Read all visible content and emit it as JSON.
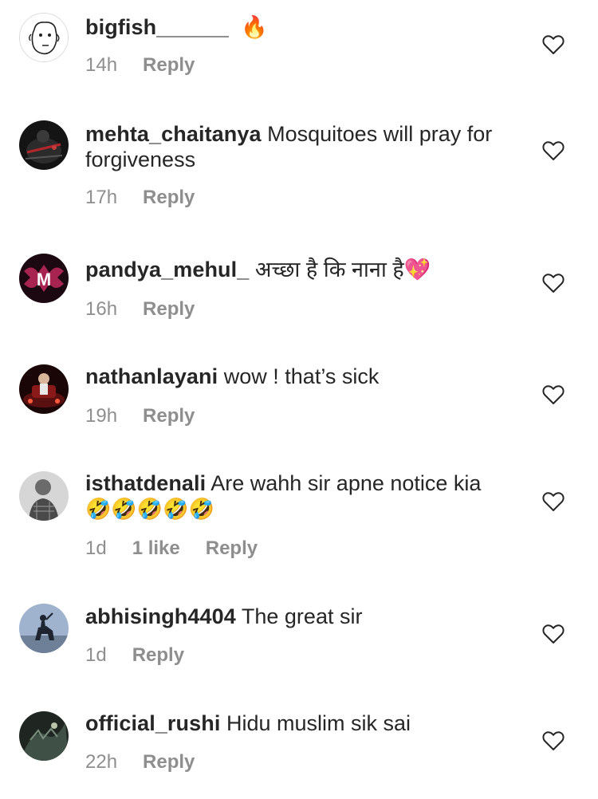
{
  "comments": [
    {
      "username": "bigfish______",
      "text": "🔥",
      "time": "14h",
      "likes": "",
      "reply_label": "Reply",
      "avatar_icon": "meme-face-avatar",
      "avatar_color": "#ffffff"
    },
    {
      "username": "mehta_chaitanya",
      "text": "Mosquitoes will pray for forgiveness",
      "time": "17h",
      "likes": "",
      "reply_label": "Reply",
      "avatar_icon": "dark-figure-avatar",
      "avatar_color": "#1b1b1b"
    },
    {
      "username": "pandya_mehul_",
      "text": "अच्छा है कि नाना है💖",
      "time": "16h",
      "likes": "",
      "reply_label": "Reply",
      "avatar_icon": "pink-m-logo-avatar",
      "avatar_color": "#2a0a14"
    },
    {
      "username": "nathanlayani",
      "text": "wow ! that’s sick",
      "time": "19h",
      "likes": "",
      "reply_label": "Reply",
      "avatar_icon": "car-photo-avatar",
      "avatar_color": "#3a0c0c"
    },
    {
      "username": "isthatdenali",
      "text": "Are wahh sir apne notice kia",
      "emojis": "🤣🤣🤣🤣🤣",
      "time": "1d",
      "likes": "1 like",
      "reply_label": "Reply",
      "avatar_icon": "person-photo-avatar",
      "avatar_color": "#9a9a9a"
    },
    {
      "username": "abhisingh4404",
      "text": "The great sir",
      "time": "1d",
      "likes": "",
      "reply_label": "Reply",
      "avatar_icon": "statue-photo-avatar",
      "avatar_color": "#7f96b8"
    },
    {
      "username": "official_rushi",
      "text": "Hidu muslim sik sai",
      "time": "22h",
      "likes": "",
      "reply_label": "Reply",
      "avatar_icon": "dark-photo-avatar",
      "avatar_color": "#27302a"
    }
  ],
  "heart_icon": "heart-outline-icon"
}
